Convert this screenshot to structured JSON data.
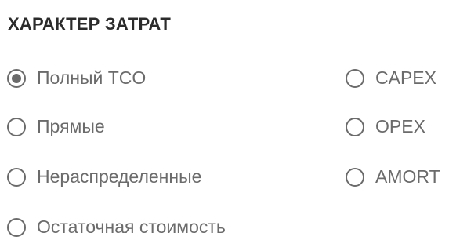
{
  "section": {
    "title": "ХАРАКТЕР ЗАТРАТ"
  },
  "options": {
    "full_tco": {
      "label": "Полный TCO",
      "checked": true
    },
    "direct": {
      "label": "Прямые",
      "checked": false
    },
    "unallocated": {
      "label": "Нераспределенные",
      "checked": false
    },
    "residual": {
      "label": "Остаточная стоимость",
      "checked": false
    },
    "capex": {
      "label": "CAPEX",
      "checked": false
    },
    "opex": {
      "label": "OPEX",
      "checked": false
    },
    "amort": {
      "label": "AMORT",
      "checked": false
    }
  },
  "colors": {
    "title": "#2b2b2b",
    "radio": "#6b6b6b",
    "label": "#6b6b6b"
  }
}
